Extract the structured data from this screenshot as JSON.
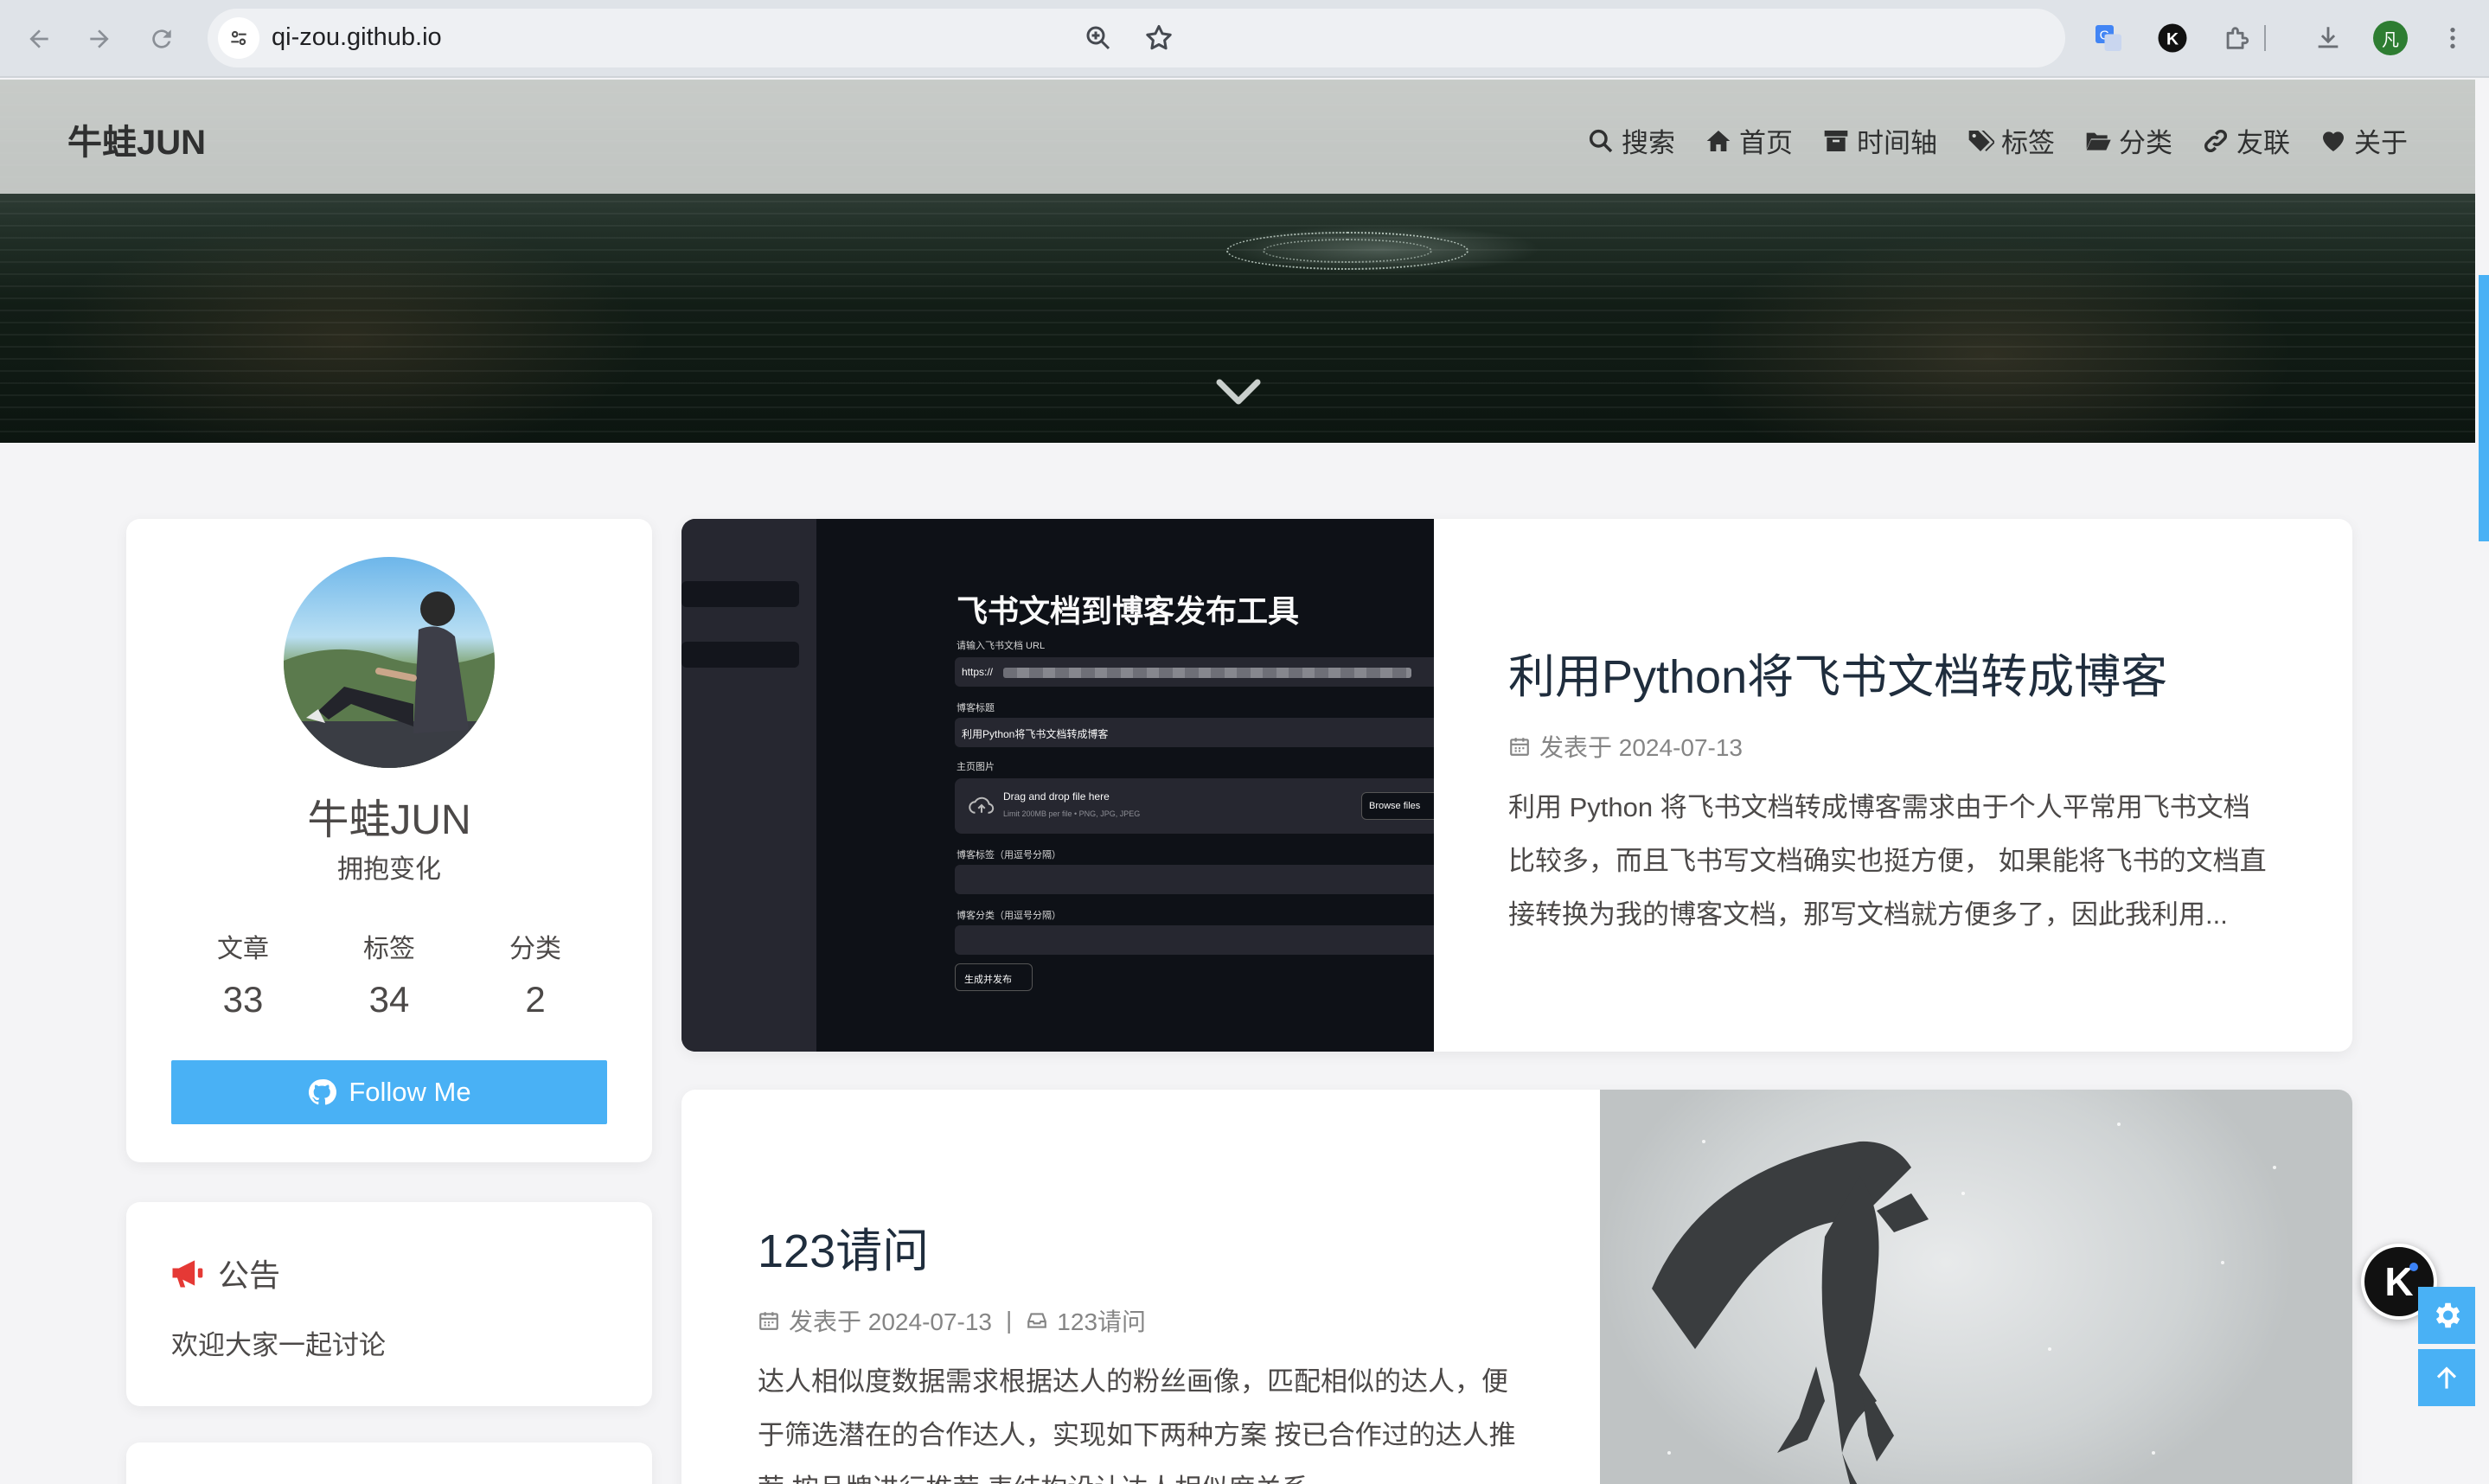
{
  "browser": {
    "url": "qi-zou.github.io",
    "profile_initial": "凡"
  },
  "site": {
    "brand": "牛蛙JUN",
    "menu": [
      {
        "label": "搜索",
        "icon": "search-icon"
      },
      {
        "label": "首页",
        "icon": "home-icon"
      },
      {
        "label": "时间轴",
        "icon": "archive-icon"
      },
      {
        "label": "标签",
        "icon": "tags-icon"
      },
      {
        "label": "分类",
        "icon": "folder-open-icon"
      },
      {
        "label": "友联",
        "icon": "link-icon"
      },
      {
        "label": "关于",
        "icon": "heart-icon"
      }
    ]
  },
  "profile": {
    "name": "牛蛙JUN",
    "description": "拥抱变化",
    "stats": [
      {
        "label": "文章",
        "value": "33"
      },
      {
        "label": "标签",
        "value": "34"
      },
      {
        "label": "分类",
        "value": "2"
      }
    ],
    "follow_label": "Follow Me"
  },
  "notice": {
    "title": "公告",
    "text": "欢迎大家一起讨论"
  },
  "posts": [
    {
      "title": "利用Python将飞书文档转成博客",
      "date": "发表于 2024-07-13",
      "excerpt_lines": [
        "利用 Python 将飞书文档转成博客需求由于个人平常用飞书文档",
        "比较多，而且飞书写文档确实也挺方便， 如果能将飞书的文档直",
        "接转换为我的博客文档，那写文档就方便多了，因此我利用..."
      ],
      "cover": {
        "title": "飞书文档到博客发布工具",
        "label_url": "请输入飞书文档 URL",
        "url_prefix": "https://",
        "label_title": "博客标题",
        "title_value": "利用Python将飞书文档转成博客",
        "label_image": "主页图片",
        "drop_text": "Drag and drop file here",
        "drop_hint": "Limit 200MB per file • PNG, JPG, JPEG",
        "browse": "Browse files",
        "label_tags": "博客标签（用逗号分隔）",
        "label_category": "博客分类（用逗号分隔）",
        "submit": "生成并发布"
      }
    },
    {
      "title": "123请问",
      "date": "发表于 2024-07-13",
      "separator": "|",
      "category": "123请问",
      "excerpt_lines": [
        "达人相似度数据需求根据达人的粉丝画像，匹配相似的达人，便",
        "于筛选潜在的合作达人，实现如下两种方案 按已合作过的达人推",
        "荐 按品牌进行推荐 表结构设计达人相似度关系..."
      ]
    }
  ],
  "floating": {
    "k_label": "K"
  }
}
